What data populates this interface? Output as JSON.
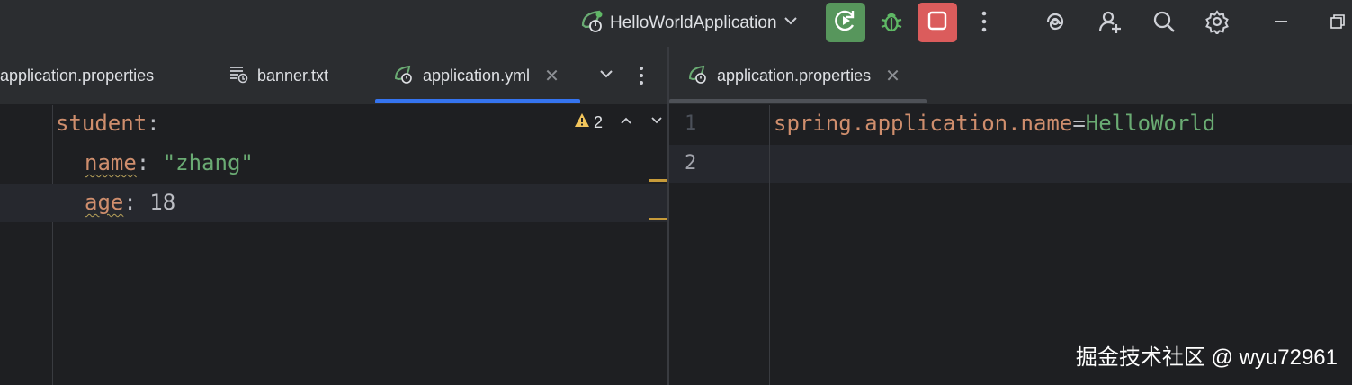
{
  "toolbar": {
    "run_config_label": "HelloWorldApplication",
    "icons": [
      "spring-run-icon",
      "chevron-down-icon",
      "rerun-icon",
      "debug-icon",
      "stop-icon",
      "more-vert-icon",
      "ai-assistant-icon",
      "add-user-icon",
      "search-icon",
      "settings-icon",
      "minimize-icon",
      "restore-icon"
    ],
    "colors": {
      "run_button": "#57965c",
      "stop_button": "#db5c5c",
      "debug": "#5fb865"
    }
  },
  "left_tabs": [
    {
      "label": "application.properties",
      "icon": "spring-icon"
    },
    {
      "label": "banner.txt",
      "icon": "text-file-icon"
    },
    {
      "label": "application.yml",
      "icon": "spring-icon",
      "active": true
    }
  ],
  "right_tabs": [
    {
      "label": "application.properties",
      "icon": "spring-icon",
      "active": true
    }
  ],
  "left_editor": {
    "warning_count": "2",
    "lines": [
      {
        "key": "student",
        "sep": ":",
        "value": ""
      },
      {
        "key": "name",
        "sep": ": ",
        "value": "\"zhang\""
      },
      {
        "key": "age",
        "sep": ": ",
        "value": "18"
      }
    ]
  },
  "right_editor": {
    "line_numbers": [
      "1",
      "2"
    ],
    "line1_key": "spring.application.name",
    "line1_eq": "=",
    "line1_value": "HelloWorld"
  },
  "watermark": "掘金技术社区 @ wyu72961"
}
